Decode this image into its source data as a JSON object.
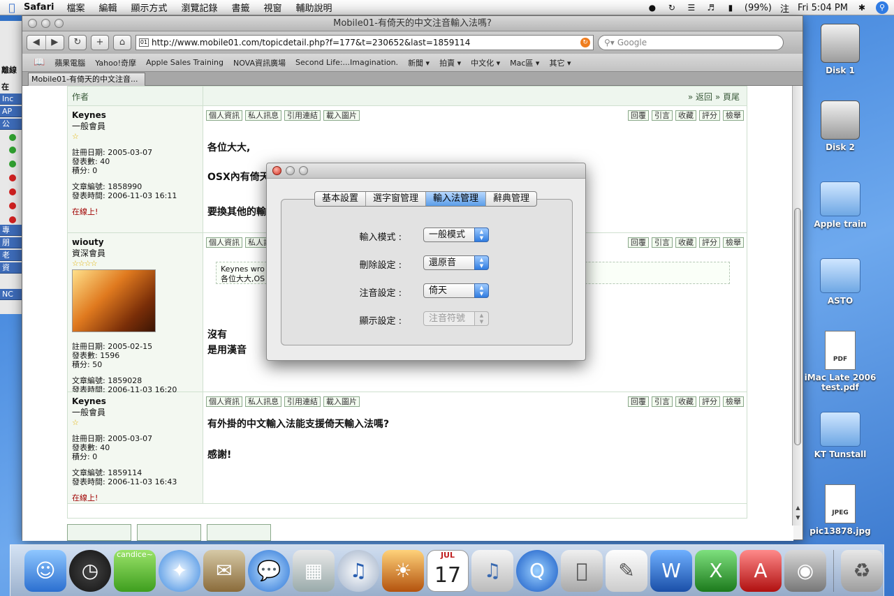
{
  "menubar": {
    "app": "Safari",
    "items": [
      "檔案",
      "編輯",
      "顯示方式",
      "瀏覽記錄",
      "書籤",
      "視窗",
      "輔助說明"
    ],
    "battery": "(99%)",
    "input_method": "注",
    "clock": "Fri 5:04 PM"
  },
  "bg_window": {
    "label": "離線",
    "label2": "在",
    "rows": [
      "Inc",
      "AP",
      "公",
      "專",
      "朋",
      "老",
      "資",
      "NC"
    ]
  },
  "safari": {
    "title": "Mobile01-有倚天的中文注音輸入法嗎?",
    "url": "http://www.mobile01.com/topicdetail.php?f=177&t=230652&last=1859114",
    "search_placeholder": "Google",
    "bookmarks": [
      "蘋果電腦",
      "Yahoo!奇摩",
      "Apple Sales Training",
      "NOVA資訊廣場",
      "Second Life:...Imagination.",
      "新聞 ▾",
      "拍賣 ▾",
      "中文化 ▾",
      "Mac區 ▾",
      "其它 ▾"
    ],
    "tab_label": "Mobile01-有倚天的中文注音..."
  },
  "forum": {
    "header_author": "作者",
    "header_nav": "» 返回 » 頁尾",
    "left_buttons": [
      "個人資訊",
      "私人訊息",
      "引用連結",
      "載入圖片"
    ],
    "right_buttons": [
      "回覆",
      "引言",
      "收藏",
      "評分",
      "檢舉"
    ],
    "posts": [
      {
        "user": "Keynes",
        "rank": "一般會員",
        "stars": "☆",
        "reg": "註冊日期: 2005-03-07",
        "count": "發表數: 40",
        "points": "積分: 0",
        "post_id": "文章編號: 1858990",
        "post_time": "發表時間: 2006-11-03 16:11",
        "online": "在線上!",
        "text1": "各位大大,",
        "text2": "OSX內有倚天",
        "text3": "要換其他的輸"
      },
      {
        "user": "wiouty",
        "rank": "資深會員",
        "stars": "☆☆☆☆",
        "reg": "註冊日期: 2005-02-15",
        "count": "發表數: 1596",
        "points": "積分: 50",
        "post_id": "文章編號: 1859028",
        "post_time": "發表時間: 2006-11-03 16:20",
        "quote1": "Keynes wro",
        "quote2": "各位大大,OS",
        "text1": "沒有",
        "text2": "是用漢音"
      },
      {
        "user": "Keynes",
        "rank": "一般會員",
        "stars": "☆",
        "reg": "註冊日期: 2005-03-07",
        "count": "發表數: 40",
        "points": "積分: 0",
        "post_id": "文章編號: 1859114",
        "post_time": "發表時間: 2006-11-03 16:43",
        "online": "在線上!",
        "text1": "有外掛的中文輸入法能支援倚天輸入法嗎?",
        "text2": "感謝!"
      }
    ]
  },
  "dialog": {
    "tabs": [
      "基本設置",
      "選字窗管理",
      "輸入法管理",
      "辭典管理"
    ],
    "selected_tab": "輸入法管理",
    "fields": [
      {
        "label": "輸入模式 :",
        "value": "一般模式",
        "enabled": true
      },
      {
        "label": "刪除設定 :",
        "value": "還原音",
        "enabled": true
      },
      {
        "label": "注音設定 :",
        "value": "倚天",
        "enabled": true
      },
      {
        "label": "顯示設定 :",
        "value": "注音符號",
        "enabled": false
      }
    ]
  },
  "desktop": {
    "icons": [
      "Disk 1",
      "Disk 2",
      "Apple train",
      "ASTO",
      "iMac Late 2006 test.pdf",
      "KT Tunstall",
      "pic13878.jpg"
    ],
    "doc_labels": [
      "PDF",
      "JPEG"
    ]
  },
  "dock": {
    "user_tag": "candice~",
    "calendar_month": "JUL",
    "calendar_day": "17"
  }
}
